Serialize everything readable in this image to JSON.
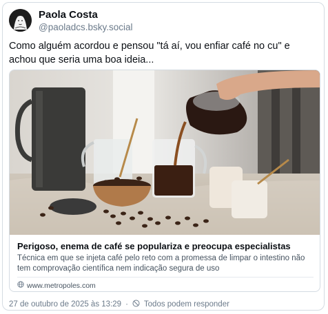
{
  "author": {
    "name": "Paola Costa",
    "handle": "@paoladcs.bsky.social",
    "avatar_icon": "avatar-illustration"
  },
  "post": {
    "text": "Como alguém acordou e pensou \"tá aí, vou enfiar café no cu\" e achou que seria uma boa ideia..."
  },
  "embed": {
    "image_icon": "coffee-pouring-photo",
    "title": "Perigoso, enema de café se populariza e preocupa especialistas",
    "description": "Técnica em que se injeta café pelo reto com a promessa de limpar o intestino não tem comprovação científica nem indicação segura de uso",
    "source": "www.metropoles.com",
    "source_icon": "globe-icon"
  },
  "footer": {
    "timestamp": "27 de outubro de 2025 às 13:29",
    "separator": "·",
    "reply_setting": "Todos podem responder",
    "reply_icon": "no-entry-icon"
  }
}
